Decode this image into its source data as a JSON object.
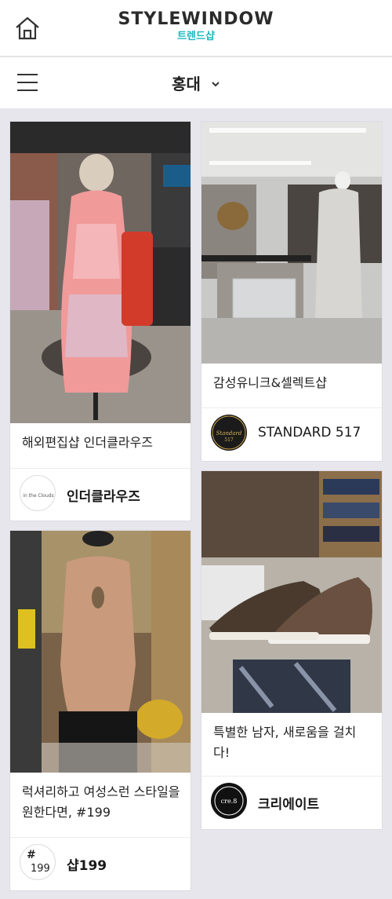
{
  "header": {
    "brand_title": "STYLEWINDOW",
    "brand_subtitle": "트렌드샵",
    "home_icon": "home-icon"
  },
  "nav": {
    "location": "홍대",
    "menu_icon": "hamburger-menu-icon",
    "dropdown_icon": "chevron-down-icon"
  },
  "cards": [
    {
      "caption": "해외편집샵 인더클라우즈",
      "shop_name": "인더클라우즈",
      "avatar_text": "in the Clouds"
    },
    {
      "caption": "감성유니크&셀렉트샵",
      "shop_name": "STANDARD 517",
      "avatar_text": "Standard 517"
    },
    {
      "caption": "특별한 남자, 새로움을 걸치다!",
      "shop_name": "크리에이트",
      "avatar_text": "cre.8"
    },
    {
      "caption": "럭셔리하고 여성스런 스타일을 원한다면, #199",
      "shop_name": "샵199",
      "avatar_text_top": "#",
      "avatar_text_bottom": "199"
    }
  ],
  "colors": {
    "accent": "#1cb7c2",
    "background": "#e6e6ec"
  }
}
